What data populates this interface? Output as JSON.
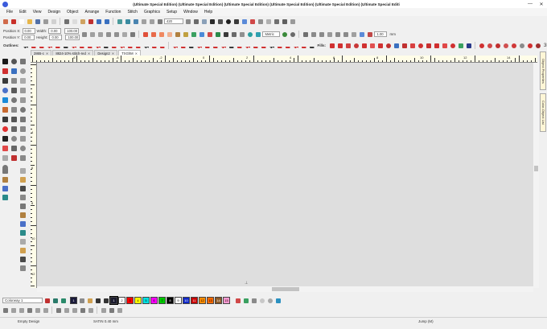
{
  "window": {
    "title": "(Ultimate Special Edition) (Ultimate Special Edition) (Ultimate Special Edition) (Ultimate Special Edition) (Ultimate Special Edition) (Ultimate Special Editi",
    "minimize": "—",
    "close": "✕"
  },
  "menu": [
    "File",
    "Edit",
    "View",
    "Design",
    "Object",
    "Arrange",
    "Function",
    "Stitch",
    "Graphics",
    "Setup",
    "Window",
    "Help"
  ],
  "toolbar1": {
    "zoom_value": "420"
  },
  "toolbar2": {
    "position_x_label": "Position X:",
    "position_x_value": "0.00",
    "position_y_label": "Position Y:",
    "position_y_value": "0.00",
    "width_label": "Width:",
    "width_value": "0.00",
    "height_label": "Height:",
    "height_value": "0.00",
    "scale_w": "100.00",
    "scale_h": "100.00",
    "units_select": "Metric",
    "stitch_length": "1.00",
    "stitch_unit": "mm"
  },
  "toolbar3": {
    "outlines_label": "Outlines:",
    "fills_label": "Fills:",
    "view3d": "3D"
  },
  "tabs": [
    {
      "label": "2865-c",
      "active": false
    },
    {
      "label": "8824-10% stitch-red",
      "active": false
    },
    {
      "label": "Design2",
      "active": false
    },
    {
      "label": "TXGhM",
      "active": true
    }
  ],
  "ruler_h_labels": [
    "-6",
    "-4",
    "-2",
    "0",
    "2",
    "4",
    "6",
    "8",
    "10",
    "12",
    "14",
    "16"
  ],
  "ruler_v_labels": [
    "2",
    "4",
    "6",
    "8",
    "10",
    "12"
  ],
  "right_panels": [
    "Object Properties",
    "Color-Object List"
  ],
  "colorbar": {
    "colorway": "Colorway 1",
    "swatches": [
      {
        "n": "1",
        "color": "#1a1a2e"
      },
      {
        "n": "2",
        "color": "#ffffff"
      },
      {
        "n": "3",
        "color": "#ff0000"
      },
      {
        "n": "4",
        "color": "#ffff00"
      },
      {
        "n": "5",
        "color": "#00e0e0"
      },
      {
        "n": "6",
        "color": "#ff00ff"
      },
      {
        "n": "7",
        "color": "#00c800"
      },
      {
        "n": "8",
        "color": "#000000"
      },
      {
        "n": "9",
        "color": "#ffffff"
      },
      {
        "n": "10",
        "color": "#1028c8"
      },
      {
        "n": "11",
        "color": "#c80000"
      },
      {
        "n": "12",
        "color": "#ff8c00"
      },
      {
        "n": "13",
        "color": "#ff6a00"
      },
      {
        "n": "14",
        "color": "#8c5a28"
      },
      {
        "n": "15",
        "color": "#ff9ad2"
      }
    ]
  },
  "status": {
    "left": "Empty Design",
    "middle": "SATIN 0.40 mm",
    "right": "Jump (M)"
  }
}
